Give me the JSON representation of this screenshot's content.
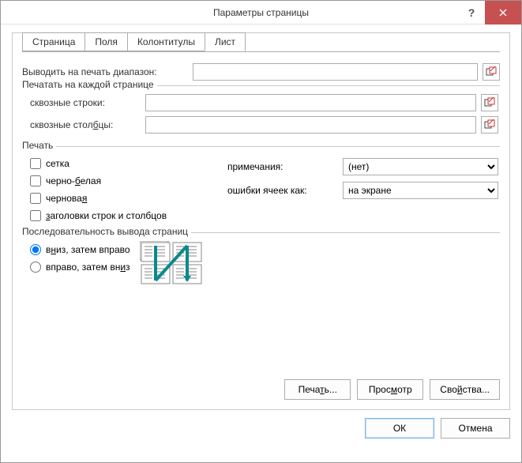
{
  "window": {
    "title": "Параметры страницы"
  },
  "tabs": {
    "page": "Страница",
    "margins": "Поля",
    "headerfooter": "Колонтитулы",
    "sheet": "Лист"
  },
  "sheet": {
    "print_range_label": "Выводить на печать диапазон:",
    "repeat_group": "Печатать на каждой странице",
    "rows_label": "сквозные строки:",
    "cols_label": "сквозные столбцы:",
    "print_group": "Печать",
    "gridlines": "сетка",
    "bw_pre": "черно-",
    "bw_acc": "б",
    "bw_post": "елая",
    "draft_pre": "чернова",
    "draft_acc": "я",
    "draft_post": "",
    "rc_pre": "",
    "rc_acc": "з",
    "rc_post": "аголовки строк и столбцов",
    "comments_label": "примечания:",
    "comments_value": "(нет)",
    "errors_label": "ошибки ячеек как:",
    "errors_value": "на экране",
    "order_group": "Последовательность вывода страниц",
    "down_pre": "в",
    "down_acc": "н",
    "down_post": "из, затем вправо",
    "over_pre": "вправо, затем вн",
    "over_acc": "и",
    "over_post": "з",
    "btn_print_pre": "Печа",
    "btn_print_acc": "т",
    "btn_print_post": "ь...",
    "btn_preview_pre": "Прос",
    "btn_preview_acc": "м",
    "btn_preview_post": "отр",
    "btn_options_pre": "Сво",
    "btn_options_acc": "й",
    "btn_options_post": "ства..."
  },
  "footer": {
    "ok": "ОК",
    "cancel": "Отмена"
  }
}
